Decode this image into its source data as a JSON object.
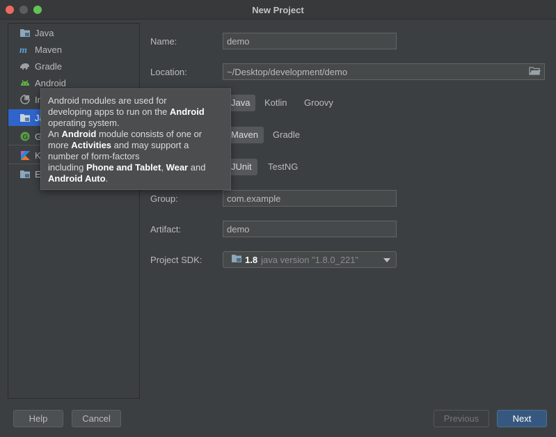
{
  "window": {
    "title": "New Project"
  },
  "sidebar": {
    "items": [
      {
        "label": "Java",
        "icon": "folder-icon"
      },
      {
        "label": "Maven",
        "icon": "maven-icon"
      },
      {
        "label": "Gradle",
        "icon": "gradle-elephant-icon"
      },
      {
        "label": "Android",
        "icon": "android-icon"
      },
      {
        "label": "In",
        "icon": "intellij-plugin-icon"
      },
      {
        "label": "Ja",
        "icon": "folder-icon",
        "selected": true
      },
      {
        "label": "G",
        "icon": "groovy-icon"
      },
      {
        "label": "Ko",
        "icon": "kotlin-icon"
      },
      {
        "label": "Er",
        "icon": "folder-icon"
      }
    ]
  },
  "form": {
    "name": {
      "label": "Name:",
      "value": "demo"
    },
    "location": {
      "label": "Location:",
      "value": "~/Desktop/development/demo"
    },
    "language": {
      "options": [
        "Java",
        "Kotlin",
        "Groovy"
      ],
      "selected": "Java"
    },
    "build_system": {
      "options": [
        "Maven",
        "Gradle"
      ],
      "selected": "Maven"
    },
    "test_framework": {
      "options": [
        "JUnit",
        "TestNG"
      ],
      "selected": "JUnit"
    },
    "group": {
      "label": "Group:",
      "value": "com.example"
    },
    "artifact": {
      "label": "Artifact:",
      "value": "demo"
    },
    "sdk": {
      "label": "Project SDK:",
      "version": "1.8",
      "description": "java version \"1.8.0_221\""
    }
  },
  "tooltip": {
    "lines": [
      [
        {
          "t": "Android modules are used for"
        }
      ],
      [
        {
          "t": "developing apps to run on the "
        },
        {
          "t": "Android",
          "b": true
        }
      ],
      [
        {
          "t": "operating system."
        }
      ],
      [
        {
          "t": "An "
        },
        {
          "t": "Android",
          "b": true
        },
        {
          "t": " module consists of one or"
        }
      ],
      [
        {
          "t": "more "
        },
        {
          "t": "Activities",
          "b": true
        },
        {
          "t": " and may support a"
        }
      ],
      [
        {
          "t": "number of form-factors"
        }
      ],
      [
        {
          "t": "including "
        },
        {
          "t": "Phone and Tablet",
          "b": true
        },
        {
          "t": ", "
        },
        {
          "t": "Wear",
          "b": true
        },
        {
          "t": " and"
        }
      ],
      [
        {
          "t": "Android Auto",
          "b": true
        },
        {
          "t": "."
        }
      ]
    ]
  },
  "buttons": {
    "help": "Help",
    "cancel": "Cancel",
    "previous": "Previous",
    "next": "Next"
  },
  "colors": {
    "background": "#3c3f41",
    "selection": "#2f65ca",
    "primary_button": "#365880"
  }
}
